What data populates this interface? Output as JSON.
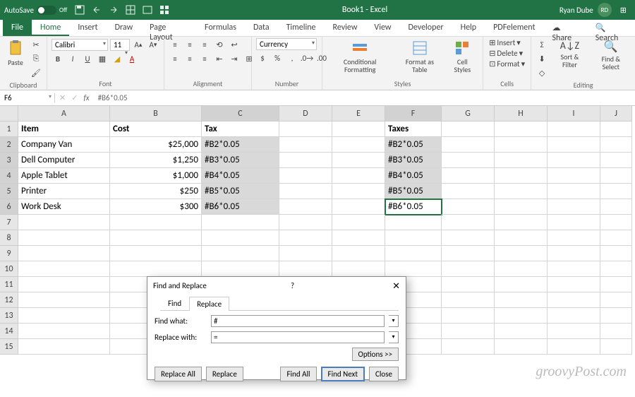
{
  "titlebar": {
    "autosave": "AutoSave",
    "autosave_state": "Off",
    "document": "Book1 - Excel",
    "user": "Ryan Dube",
    "user_initials": "RD"
  },
  "tabs": [
    "File",
    "Home",
    "Insert",
    "Draw",
    "Page Layout",
    "Formulas",
    "Data",
    "Timeline",
    "Review",
    "View",
    "Developer",
    "Help",
    "PDFelement"
  ],
  "active_tab": "Home",
  "share": "Share",
  "search": "Search",
  "ribbon": {
    "clipboard": {
      "label": "Clipboard",
      "paste": "Paste"
    },
    "font": {
      "label": "Font",
      "font": "Calibri",
      "size": "11"
    },
    "alignment": {
      "label": "Alignment"
    },
    "number": {
      "label": "Number",
      "format": "Currency"
    },
    "styles": {
      "label": "Styles",
      "conditional": "Conditional Formatting",
      "table": "Format as Table",
      "cell": "Cell Styles"
    },
    "cells": {
      "label": "Cells",
      "insert": "Insert",
      "delete": "Delete",
      "format": "Format"
    },
    "editing": {
      "label": "Editing",
      "sort": "Sort & Filter",
      "find": "Find & Select"
    }
  },
  "formula_bar": {
    "name": "F6",
    "formula": "#B6*0.05"
  },
  "columns": [
    "A",
    "B",
    "C",
    "D",
    "E",
    "F",
    "G",
    "H",
    "I",
    "J"
  ],
  "rows": [
    "1",
    "2",
    "3",
    "4",
    "5",
    "6",
    "7",
    "8",
    "9",
    "10",
    "11",
    "12",
    "13",
    "14",
    "15"
  ],
  "data": {
    "headers": {
      "A": "Item",
      "B": "Cost",
      "C": "Tax",
      "F": "Taxes"
    },
    "body": [
      {
        "A": "Company Van",
        "B": "$25,000",
        "C": "#B2*0.05",
        "F": "#B2*0.05"
      },
      {
        "A": "Dell Computer",
        "B": "$1,250",
        "C": "#B3*0.05",
        "F": "#B3*0.05"
      },
      {
        "A": "Apple Tablet",
        "B": "$1,000",
        "C": "#B4*0.05",
        "F": "#B4*0.05"
      },
      {
        "A": "Printer",
        "B": "$250",
        "C": "#B5*0.05",
        "F": "#B5*0.05"
      },
      {
        "A": "Work Desk",
        "B": "$300",
        "C": "#B6*0.05",
        "F": "#B6*0.05"
      }
    ]
  },
  "dialog": {
    "title": "Find and Replace",
    "tabs": [
      "Find",
      "Replace"
    ],
    "active_tab": "Replace",
    "find_label": "Find what:",
    "find_value": "#",
    "replace_label": "Replace with:",
    "replace_value": "=",
    "options": "Options >>",
    "buttons": {
      "replace_all": "Replace All",
      "replace": "Replace",
      "find_all": "Find All",
      "find_next": "Find Next",
      "close": "Close"
    }
  },
  "watermark": "groovyPost.com"
}
